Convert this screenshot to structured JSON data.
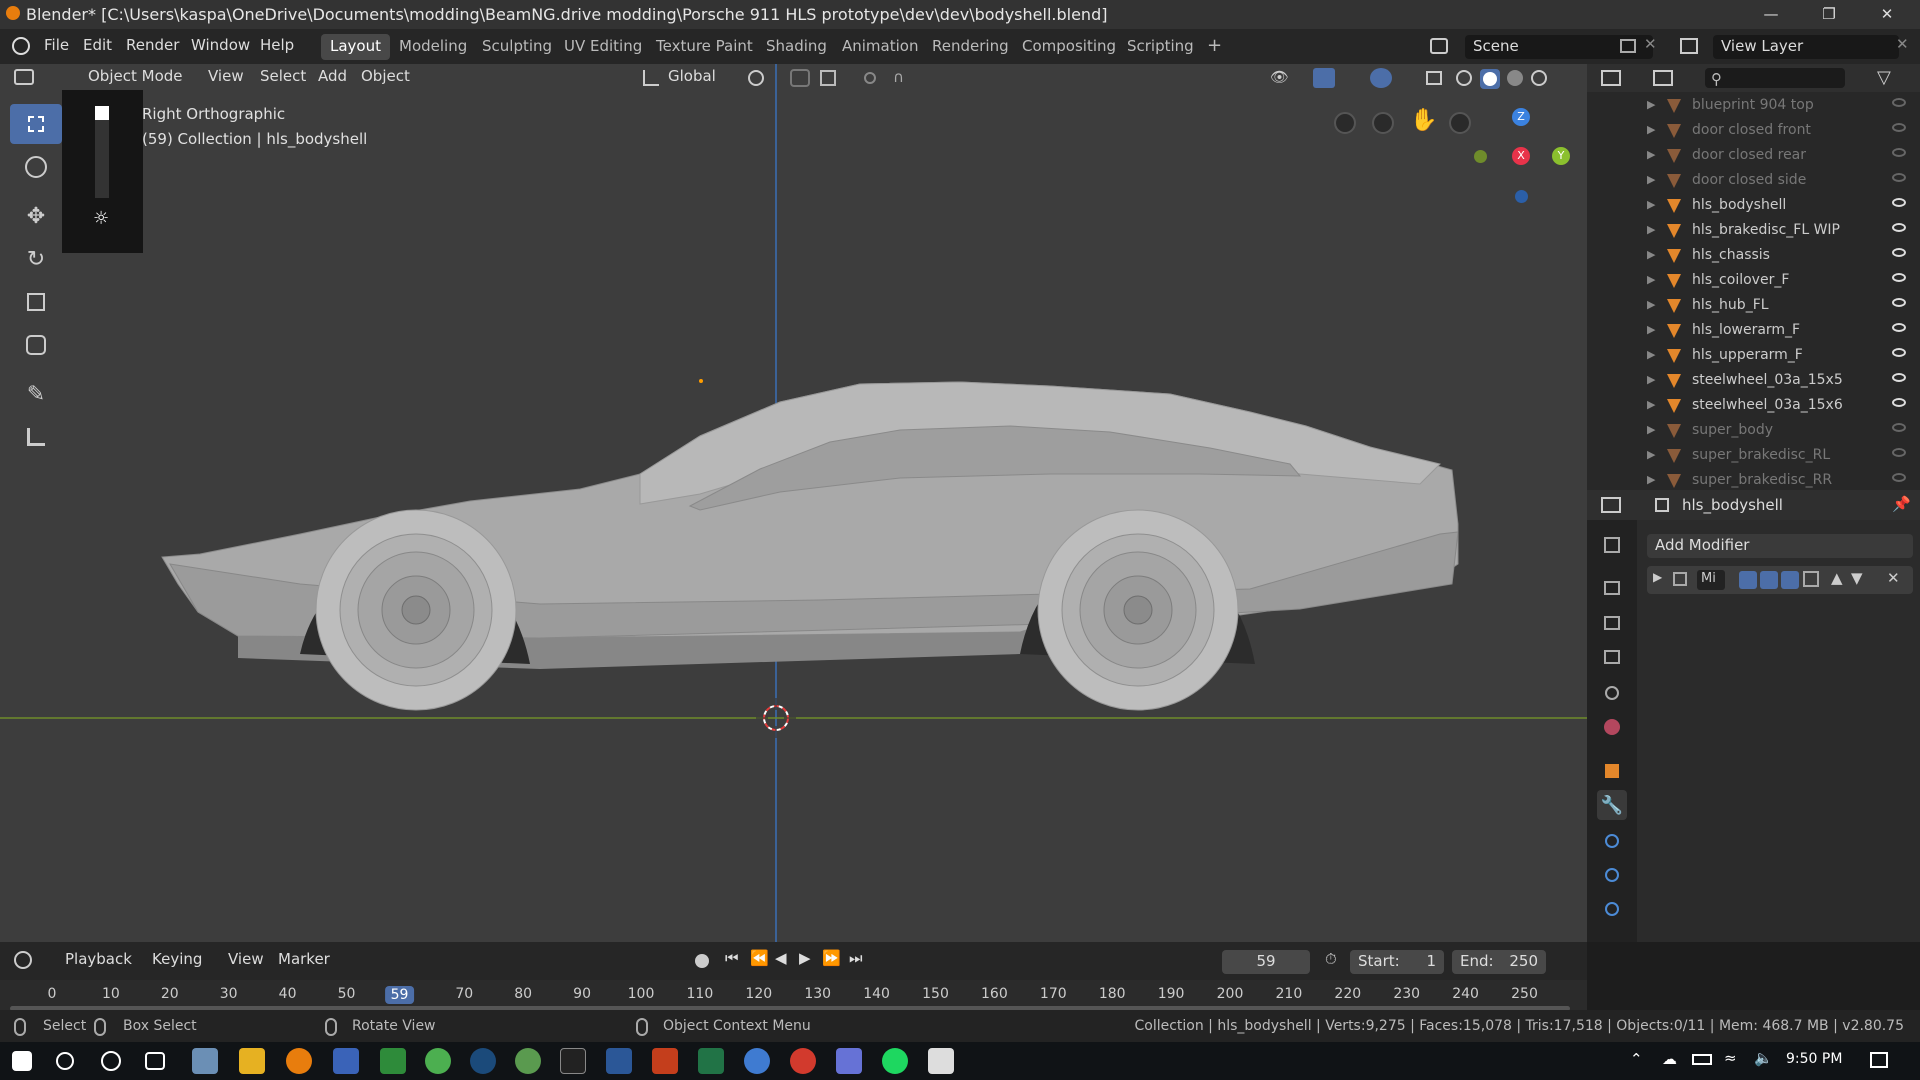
{
  "titlebar": {
    "title": "Blender* [C:\\Users\\kaspa\\OneDrive\\Documents\\modding\\BeamNG.drive modding\\Porsche 911 HLS prototype\\dev\\dev\\bodyshell.blend]"
  },
  "menu": [
    "File",
    "Edit",
    "Render",
    "Window",
    "Help"
  ],
  "workspaces": [
    "Layout",
    "Modeling",
    "Sculpting",
    "UV Editing",
    "Texture Paint",
    "Shading",
    "Animation",
    "Rendering",
    "Compositing",
    "Scripting"
  ],
  "active_workspace": "Layout",
  "scene": {
    "label": "Scene",
    "view_layer": "View Layer"
  },
  "viewport_header": {
    "mode": "Object Mode",
    "menus": [
      "View",
      "Select",
      "Add",
      "Object"
    ],
    "orientation": "Global"
  },
  "viewport": {
    "view_name": "Right Orthographic",
    "collection": "(59) Collection | hls_bodyshell"
  },
  "gizmo": {
    "x": "X",
    "y": "Y",
    "z": "Z"
  },
  "outliner": [
    {
      "name": "blueprint 904 top",
      "dim": true
    },
    {
      "name": "door closed front",
      "dim": true
    },
    {
      "name": "door closed rear",
      "dim": true
    },
    {
      "name": "door closed side",
      "dim": true
    },
    {
      "name": "hls_bodyshell",
      "dim": false
    },
    {
      "name": "hls_brakedisc_FL WIP",
      "dim": false
    },
    {
      "name": "hls_chassis",
      "dim": false
    },
    {
      "name": "hls_coilover_F",
      "dim": false
    },
    {
      "name": "hls_hub_FL",
      "dim": false
    },
    {
      "name": "hls_lowerarm_F",
      "dim": false
    },
    {
      "name": "hls_upperarm_F",
      "dim": false
    },
    {
      "name": "steelwheel_03a_15x5",
      "dim": false
    },
    {
      "name": "steelwheel_03a_15x6",
      "dim": false
    },
    {
      "name": "super_body",
      "dim": true
    },
    {
      "name": "super_brakedisc_RL",
      "dim": true
    },
    {
      "name": "super_brakedisc_RR",
      "dim": true
    }
  ],
  "properties": {
    "object": "hls_bodyshell",
    "add_modifier": "Add Modifier",
    "modifier_short": "Mi"
  },
  "timeline": {
    "menus": [
      "Playback",
      "Keying",
      "View",
      "Marker"
    ],
    "current_frame": "59",
    "start_label": "Start:",
    "start": "1",
    "end_label": "End:",
    "end": "250",
    "ticks": [
      "0",
      "10",
      "20",
      "30",
      "40",
      "50",
      "59",
      "70",
      "80",
      "90",
      "100",
      "110",
      "120",
      "130",
      "140",
      "150",
      "160",
      "170",
      "180",
      "190",
      "200",
      "210",
      "220",
      "230",
      "240",
      "250"
    ]
  },
  "status": {
    "select": "Select",
    "box_select": "Box Select",
    "rotate": "Rotate View",
    "context": "Object Context Menu",
    "info": "Collection | hls_bodyshell | Verts:9,275 | Faces:15,078 | Tris:17,518 | Objects:0/11 | Mem: 468.7 MB | v2.80.75"
  },
  "taskbar": {
    "time": "9:50 PM"
  },
  "colors": {
    "accent": "#4c6ea8",
    "x_axis": "#e8334a",
    "y_axis": "#8bc02e",
    "z_axis": "#3b82e0",
    "active_frame": "#4c6ea8"
  }
}
